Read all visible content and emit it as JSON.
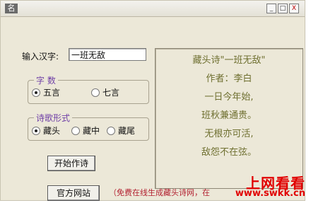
{
  "window": {
    "title_icon_char": "名",
    "controls": {
      "minimize": "_",
      "maximize": "□",
      "close": "X"
    }
  },
  "form": {
    "chinese_label": "输入汉字:",
    "chinese_value": "一班无敌",
    "font_group_title": "字  数",
    "font_options": [
      "五言",
      "七言"
    ],
    "font_selected": "五言",
    "style_group_title": "诗歌形式",
    "style_options": [
      "藏头",
      "藏中",
      "藏尾"
    ],
    "style_selected": "藏头"
  },
  "buttons": {
    "generate": "开始作诗",
    "website": "官方网站"
  },
  "poem": {
    "title": "藏头诗\"一班无敌\"",
    "author": "作者：李白",
    "lines": [
      "一日今年始,",
      "班秋兼通贵。",
      "无根亦可活,",
      "敌怨不在弦。"
    ]
  },
  "note": "（免费在线生成藏头诗网，在",
  "watermark": {
    "title": "上网看看",
    "url": "www.swkk.cn"
  }
}
